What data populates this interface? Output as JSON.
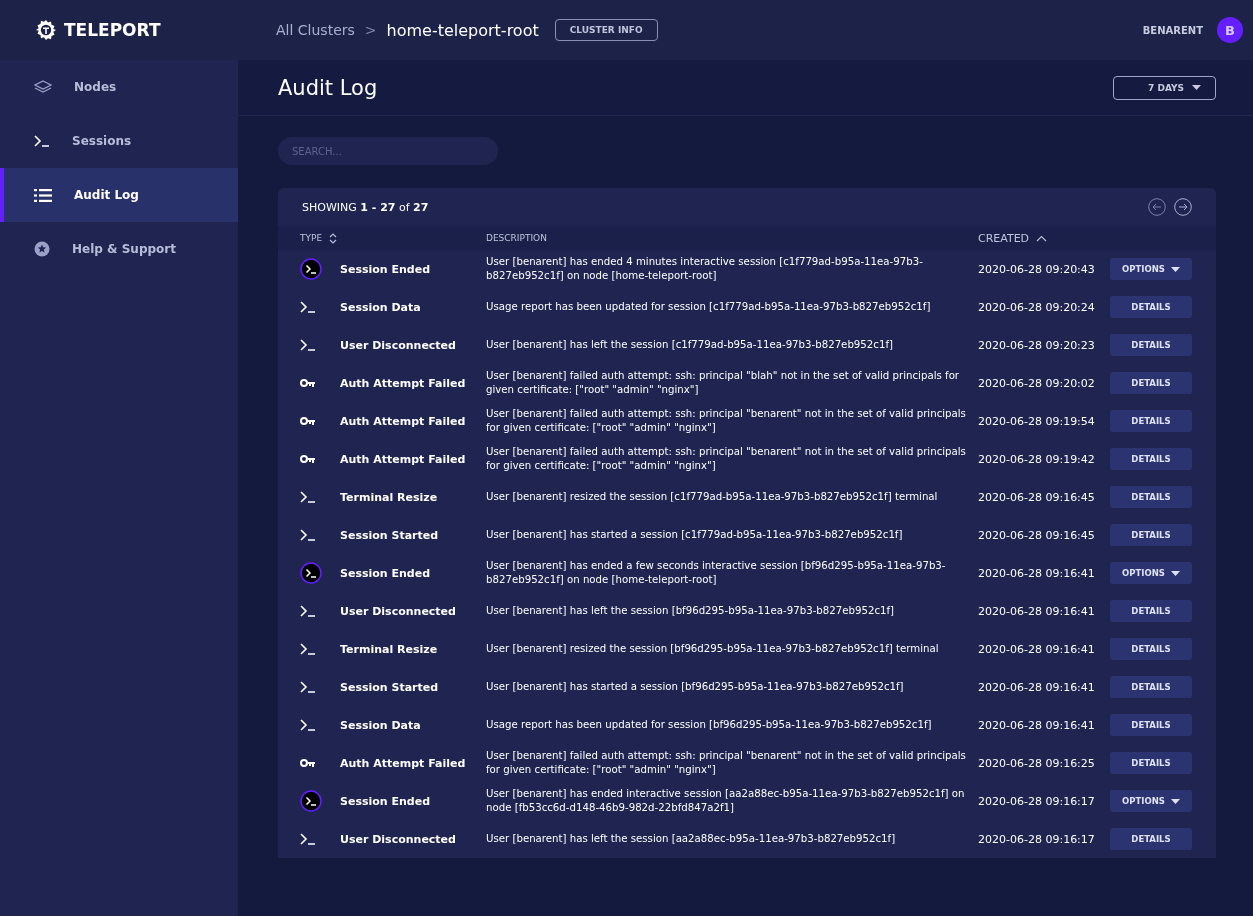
{
  "brand": {
    "name": "TELEPORT"
  },
  "breadcrumb": {
    "root": "All Clusters",
    "separator": ">",
    "current": "home-teleport-root",
    "button": "CLUSTER INFO"
  },
  "user": {
    "name": "BENARENT",
    "initial": "B"
  },
  "sidebar": {
    "items": [
      {
        "kind": "nodes",
        "label": "Nodes",
        "selected": false
      },
      {
        "kind": "sessions",
        "label": "Sessions",
        "selected": false
      },
      {
        "kind": "audit",
        "label": "Audit Log",
        "selected": true
      },
      {
        "kind": "help",
        "label": "Help & Support",
        "selected": false
      }
    ]
  },
  "page": {
    "title": "Audit Log",
    "range": "7 DAYS"
  },
  "search": {
    "placeholder": "SEARCH..."
  },
  "table": {
    "showing": "SHOWING **1 - 27** of **27**",
    "columns": [
      {
        "label": "TYPE",
        "sorted": false
      },
      {
        "label": "DESCRIPTION"
      },
      {
        "label": "CREATED",
        "sorted": true
      }
    ],
    "rows": [
      {
        "kind": "session_end",
        "type": "Session Ended",
        "description": "User [benarent] has ended 4 minutes interactive session [c1f779ad-b95a-11ea-97b3-b827eb952c1f] on node [home-teleport-root]",
        "created": "2020-06-28 09:20:43",
        "action": "OPTIONS",
        "dropdown": true
      },
      {
        "kind": "terminal",
        "type": "Session Data",
        "description": "Usage report has been updated for session [c1f779ad-b95a-11ea-97b3-b827eb952c1f]",
        "created": "2020-06-28 09:20:24",
        "action": "DETAILS",
        "dropdown": false
      },
      {
        "kind": "terminal",
        "type": "User Disconnected",
        "description": "User [benarent] has left the session [c1f779ad-b95a-11ea-97b3-b827eb952c1f]",
        "created": "2020-06-28 09:20:23",
        "action": "DETAILS",
        "dropdown": false
      },
      {
        "kind": "key",
        "type": "Auth Attempt Failed",
        "description": "User [benarent] failed auth attempt: ssh: principal \"blah\" not in the set of valid principals for given certificate: [\"root\" \"admin\" \"nginx\"]",
        "created": "2020-06-28 09:20:02",
        "action": "DETAILS",
        "dropdown": false
      },
      {
        "kind": "key",
        "type": "Auth Attempt Failed",
        "description": "User [benarent] failed auth attempt: ssh: principal \"benarent\" not in the set of valid principals for given certificate: [\"root\" \"admin\" \"nginx\"]",
        "created": "2020-06-28 09:19:54",
        "action": "DETAILS",
        "dropdown": false
      },
      {
        "kind": "key",
        "type": "Auth Attempt Failed",
        "description": "User [benarent] failed auth attempt: ssh: principal \"benarent\" not in the set of valid principals for given certificate: [\"root\" \"admin\" \"nginx\"]",
        "created": "2020-06-28 09:19:42",
        "action": "DETAILS",
        "dropdown": false
      },
      {
        "kind": "terminal",
        "type": "Terminal Resize",
        "description": "User [benarent] resized the session [c1f779ad-b95a-11ea-97b3-b827eb952c1f] terminal",
        "created": "2020-06-28 09:16:45",
        "action": "DETAILS",
        "dropdown": false
      },
      {
        "kind": "terminal",
        "type": "Session Started",
        "description": "User [benarent] has started a session [c1f779ad-b95a-11ea-97b3-b827eb952c1f]",
        "created": "2020-06-28 09:16:45",
        "action": "DETAILS",
        "dropdown": false
      },
      {
        "kind": "session_end",
        "type": "Session Ended",
        "description": "User [benarent] has ended a few seconds interactive session [bf96d295-b95a-11ea-97b3-b827eb952c1f] on node [home-teleport-root]",
        "created": "2020-06-28 09:16:41",
        "action": "OPTIONS",
        "dropdown": true
      },
      {
        "kind": "terminal",
        "type": "User Disconnected",
        "description": "User [benarent] has left the session [bf96d295-b95a-11ea-97b3-b827eb952c1f]",
        "created": "2020-06-28 09:16:41",
        "action": "DETAILS",
        "dropdown": false
      },
      {
        "kind": "terminal",
        "type": "Terminal Resize",
        "description": "User [benarent] resized the session [bf96d295-b95a-11ea-97b3-b827eb952c1f] terminal",
        "created": "2020-06-28 09:16:41",
        "action": "DETAILS",
        "dropdown": false
      },
      {
        "kind": "terminal",
        "type": "Session Started",
        "description": "User [benarent] has started a session [bf96d295-b95a-11ea-97b3-b827eb952c1f]",
        "created": "2020-06-28 09:16:41",
        "action": "DETAILS",
        "dropdown": false
      },
      {
        "kind": "terminal",
        "type": "Session Data",
        "description": "Usage report has been updated for session [bf96d295-b95a-11ea-97b3-b827eb952c1f]",
        "created": "2020-06-28 09:16:41",
        "action": "DETAILS",
        "dropdown": false
      },
      {
        "kind": "key",
        "type": "Auth Attempt Failed",
        "description": "User [benarent] failed auth attempt: ssh: principal \"benarent\" not in the set of valid principals for given certificate: [\"root\" \"admin\" \"nginx\"]",
        "created": "2020-06-28 09:16:25",
        "action": "DETAILS",
        "dropdown": false
      },
      {
        "kind": "session_end",
        "type": "Session Ended",
        "description": "User [benarent] has ended interactive session [aa2a88ec-b95a-11ea-97b3-b827eb952c1f] on node [fb53cc6d-d148-46b9-982d-22bfd847a2f1]",
        "created": "2020-06-28 09:16:17",
        "action": "OPTIONS",
        "dropdown": true
      },
      {
        "kind": "terminal",
        "type": "User Disconnected",
        "description": "User [benarent] has left the session [aa2a88ec-b95a-11ea-97b3-b827eb952c1f]",
        "created": "2020-06-28 09:16:17",
        "action": "DETAILS",
        "dropdown": false
      }
    ]
  }
}
